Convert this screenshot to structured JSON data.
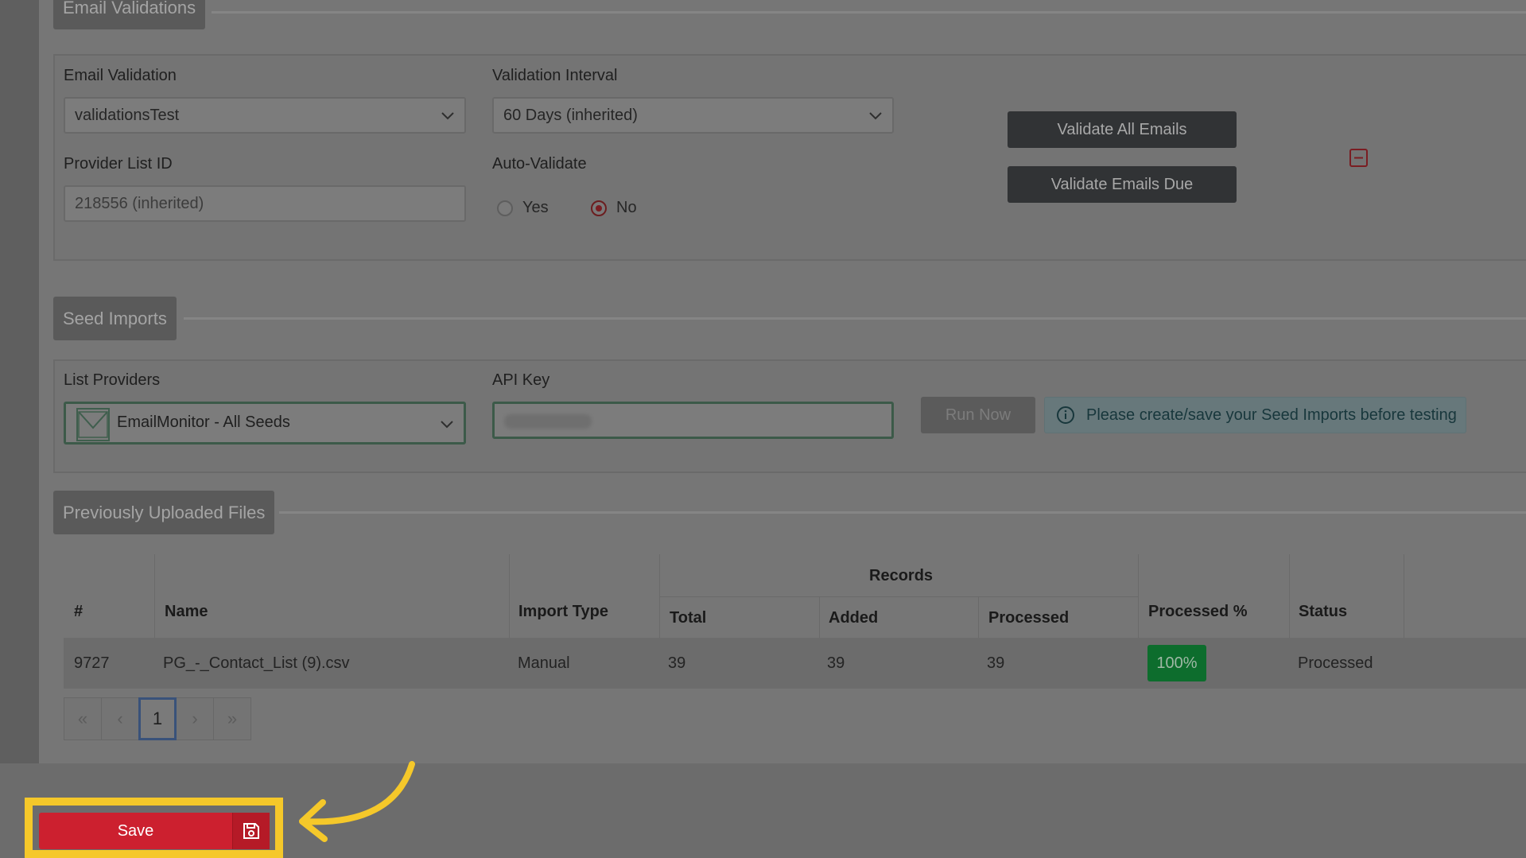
{
  "email_validations": {
    "section_title": "Email Validations",
    "email_validation_label": "Email Validation",
    "email_validation_value": "validationsTest",
    "validation_interval_label": "Validation Interval",
    "validation_interval_value": "60 Days (inherited)",
    "provider_list_id_label": "Provider List ID",
    "provider_list_id_value": "218556 (inherited)",
    "auto_validate_label": "Auto-Validate",
    "auto_validate_options": [
      "Yes",
      "No"
    ],
    "auto_validate_selected": "No",
    "validate_all_button": "Validate All Emails",
    "validate_due_button": "Validate Emails Due"
  },
  "seed_imports": {
    "section_title": "Seed Imports",
    "list_providers_label": "List Providers",
    "list_providers_value": "EmailMonitor - All Seeds",
    "api_key_label": "API Key",
    "run_now_button": "Run Now",
    "info_message": "Please create/save your Seed Imports before testing"
  },
  "uploaded_files": {
    "section_title": "Previously Uploaded Files",
    "headers": {
      "number": "#",
      "name": "Name",
      "import_type": "Import Type",
      "records_group": "Records",
      "total": "Total",
      "added": "Added",
      "processed": "Processed",
      "processed_pct": "Processed %",
      "status": "Status"
    },
    "rows": [
      {
        "number": "9727",
        "name": "PG_-_Contact_List (9).csv",
        "import_type": "Manual",
        "total": "39",
        "added": "39",
        "processed": "39",
        "processed_pct": "100%",
        "status": "Processed"
      }
    ],
    "pagination": {
      "first": "«",
      "prev": "‹",
      "current": "1",
      "next": "›",
      "last": "»"
    }
  },
  "footer": {
    "save_label": "Save"
  },
  "colors": {
    "save_red": "#cc202f",
    "highlight_yellow": "#f5c82a",
    "success_green": "#0d6d2d"
  },
  "icons": [
    "chevron-down-icon",
    "collapse-icon",
    "envelope-icon",
    "info-icon",
    "save-icon",
    "arrow-icon"
  ]
}
